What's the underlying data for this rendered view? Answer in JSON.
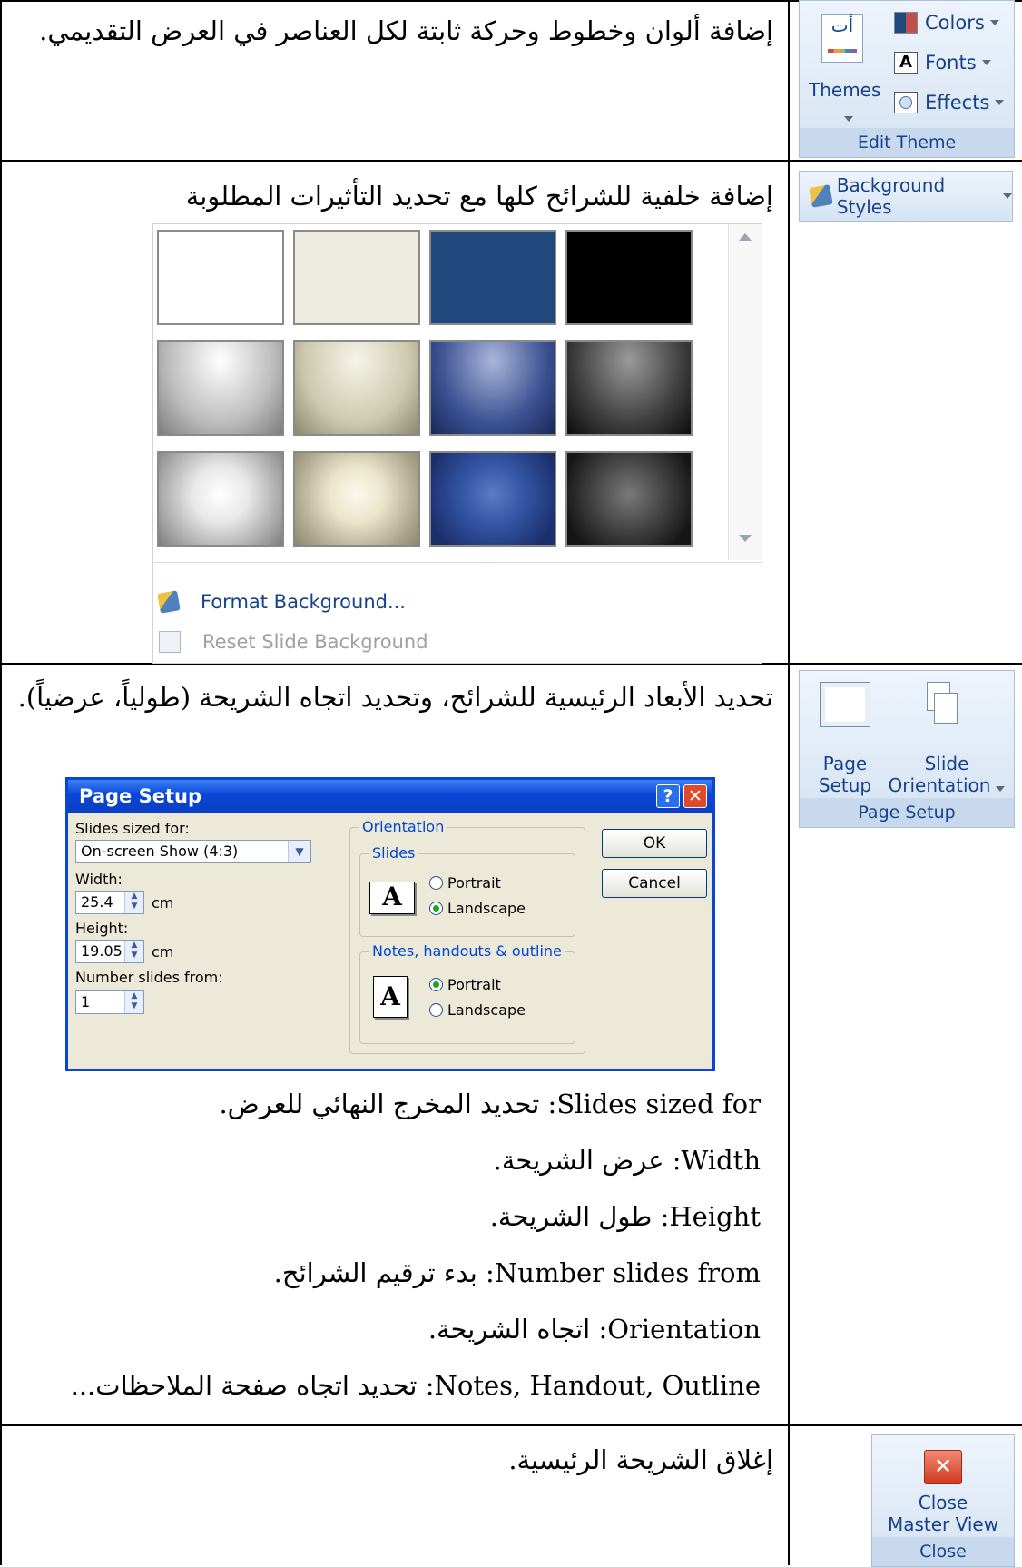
{
  "rows": {
    "r1": {
      "text": "إضافة ألوان وخطوط وحركة ثابتة لكل العناصر في العرض التقديمي."
    },
    "r2": {
      "text": "إضافة خلفية للشرائح كلها مع تحديد التأثيرات المطلوبة"
    },
    "r3": {
      "text": "تحديد الأبعاد الرئيسية للشرائح، وتحديد اتجاه الشريحة (طولياً، عرضياً)."
    },
    "r4": {
      "text": "إغلاق الشريحة الرئيسية."
    }
  },
  "edit_theme": {
    "themes_label": "Themes",
    "themes_icon_text": "أت",
    "colors_label": "Colors",
    "fonts_label": "Fonts",
    "effects_label": "Effects",
    "group_title": "Edit Theme"
  },
  "background": {
    "button_label": "Background Styles",
    "format_background": "Format Background...",
    "reset_background": "Reset Slide Background",
    "tile_colors": [
      "#ffffff",
      "#eeece1",
      "#1f497d",
      "#000000"
    ]
  },
  "page_setup_ribbon": {
    "page_setup_label1": "Page",
    "page_setup_label2": "Setup",
    "orientation_label1": "Slide",
    "orientation_label2": "Orientation",
    "group_title": "Page Setup"
  },
  "dialog": {
    "title": "Page Setup",
    "help": "?",
    "close": "✕",
    "slides_sized_for_label": "Slides sized for:",
    "slides_sized_for_value": "On-screen Show (4:3)",
    "width_label": "Width:",
    "width_value": "25.4",
    "width_unit": "cm",
    "height_label": "Height:",
    "height_value": "19.05",
    "height_unit": "cm",
    "number_slides_label": "Number slides from:",
    "number_slides_value": "1",
    "orientation_group": "Orientation",
    "slides_group": "Slides",
    "notes_group": "Notes, handouts & outline",
    "portrait": "Portrait",
    "landscape": "Landscape",
    "icon_letter": "A",
    "ok": "OK",
    "cancel": "Cancel"
  },
  "definitions": [
    {
      "term": "Slides sized for",
      "desc": ": تحديد المخرج النهائي للعرض."
    },
    {
      "term": "Width",
      "desc": ": عرض الشريحة."
    },
    {
      "term": "Height",
      "desc": ": طول الشريحة."
    },
    {
      "term": "Number slides from",
      "desc": ": بدء ترقيم الشرائح."
    },
    {
      "term": "Orientation",
      "desc": ": اتجاه الشريحة."
    },
    {
      "term": "Notes, Handout, Outline",
      "desc": ": تحديد اتجاه صفحة الملاحظات..."
    }
  ],
  "close_ribbon": {
    "label1": "Close",
    "label2": "Master View",
    "group_title": "Close"
  }
}
